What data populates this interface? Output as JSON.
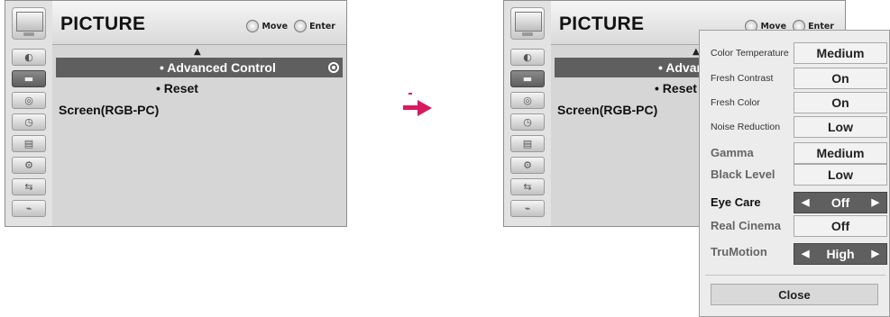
{
  "left_screen": {
    "title": "PICTURE",
    "hint_move": "Move",
    "hint_enter": "Enter",
    "items": [
      {
        "label": "• Advanced Control",
        "selected": true
      },
      {
        "label": "• Reset",
        "selected": false
      },
      {
        "label": "Screen(RGB-PC)",
        "selected": false
      }
    ]
  },
  "right_screen": {
    "title": "PICTURE",
    "hint_move": "Move",
    "hint_enter": "Enter",
    "items": [
      {
        "label": "• Advanced Control",
        "selected": true
      },
      {
        "label": "• Reset",
        "selected": false
      },
      {
        "label": "Screen(RGB-PC)",
        "selected": false
      }
    ]
  },
  "side_icons": [
    "satellite-dish-icon",
    "picture-icon",
    "audio-icon",
    "clock-icon",
    "lock-icon",
    "settings-icon",
    "input-icon",
    "usb-icon"
  ],
  "popup": {
    "rows": [
      {
        "label": "Color Temperature",
        "value": "Medium",
        "arrows": false
      },
      {
        "label": "Fresh Contrast",
        "value": "On",
        "arrows": false
      },
      {
        "label": "Fresh Color",
        "value": "On",
        "arrows": false
      },
      {
        "label": "Noise Reduction",
        "value": "Low",
        "arrows": false
      },
      {
        "label": "Gamma",
        "value": "Medium",
        "arrows": false
      },
      {
        "label": "Black Level",
        "value": "Low",
        "arrows": false
      },
      {
        "label": "Eye Care",
        "value": "Off",
        "arrows": true
      },
      {
        "label": "Real Cinema",
        "value": "Off",
        "arrows": false
      },
      {
        "label": "TruMotion",
        "value": "High",
        "arrows": true
      }
    ],
    "close_label": "Close"
  },
  "colors": {
    "arrow": "#d81860",
    "selected_bar": "#5f5f5f",
    "panel": "#d6d6d6"
  }
}
